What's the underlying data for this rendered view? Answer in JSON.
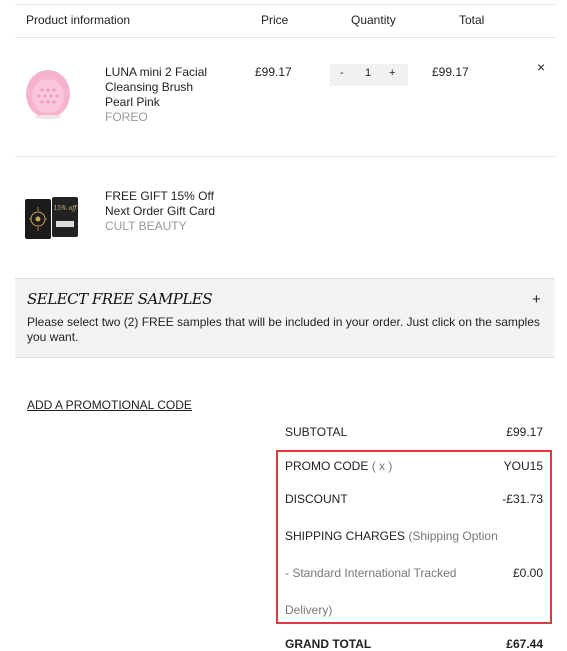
{
  "header": {
    "product_info": "Product information",
    "price": "Price",
    "quantity": "Quantity",
    "total": "Total"
  },
  "items": [
    {
      "name_line1": "LUNA mini 2 Facial",
      "name_line2": "Cleansing Brush",
      "name_line3": "Pearl Pink",
      "brand": "FOREO",
      "price": "£99.17",
      "qty_minus": "-",
      "qty": "1",
      "qty_plus": "+",
      "total": "£99.17",
      "remove": "×",
      "color": "#f4a7c9"
    },
    {
      "name_line1": "FREE GIFT 15% Off",
      "name_line2": "Next Order Gift Card",
      "brand": "CULT BEAUTY",
      "card_text": "15% off"
    }
  ],
  "samples": {
    "title": "SELECT FREE SAMPLES",
    "toggle": "+",
    "description": "Please select two (2) FREE samples that will be included in your order. Just click on the samples you want."
  },
  "promo_link": "ADD A PROMOTIONAL CODE",
  "summary": {
    "subtotal_label": "SUBTOTAL",
    "subtotal_value": "£99.17",
    "promo_label": "PROMO CODE",
    "promo_remove": "( x )",
    "promo_value": "YOU15",
    "discount_label": "DISCOUNT",
    "discount_value": "-£31.73",
    "shipping_label": "SHIPPING CHARGES",
    "shipping_option_1": "(Shipping Option",
    "shipping_option_2": "- Standard International Tracked",
    "shipping_option_3": "Delivery)",
    "shipping_value": "£0.00",
    "grand_total_label": "GRAND TOTAL",
    "grand_total_value": "£67.44"
  },
  "accent_highlight": "#e0393e"
}
